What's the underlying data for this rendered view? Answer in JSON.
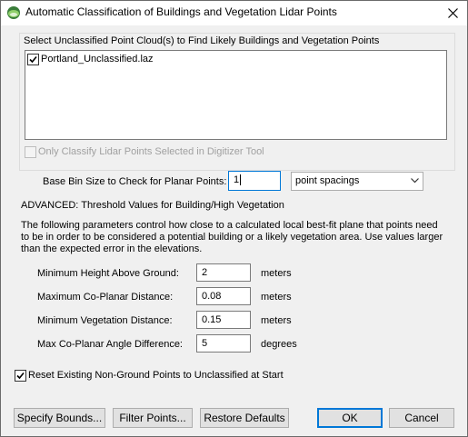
{
  "window": {
    "title": "Automatic Classification of Buildings and Vegetation Lidar Points"
  },
  "point_clouds": {
    "label": "Select Unclassified Point Cloud(s) to Find Likely Buildings and Vegetation Points",
    "items": [
      {
        "name": "Portland_Unclassified.laz",
        "checked": true
      }
    ],
    "only_selected_label": "Only Classify Lidar Points Selected in Digitizer Tool"
  },
  "bin_size": {
    "label": "Base Bin Size to Check for Planar Points:",
    "value": "1",
    "unit_selected": "point spacings"
  },
  "advanced": {
    "heading": "ADVANCED: Threshold Values for Building/High Vegetation",
    "description": [
      "The following parameters control how close to a calculated local best-fit plane that points need",
      "to be in order to be considered a potential building or a likely vegetation area. Use values larger",
      "than the expected error in the elevations."
    ],
    "params": [
      {
        "label": "Minimum Height Above Ground:",
        "value": "2",
        "unit": "meters"
      },
      {
        "label": "Maximum Co-Planar Distance:",
        "value": "0.08",
        "unit": "meters"
      },
      {
        "label": "Minimum Vegetation Distance:",
        "value": "0.15",
        "unit": "meters"
      },
      {
        "label": "Max Co-Planar Angle Difference:",
        "value": "5",
        "unit": "degrees"
      }
    ]
  },
  "reset_option": {
    "label": "Reset Existing Non-Ground Points to Unclassified at Start",
    "checked": true
  },
  "buttons": {
    "specify_bounds": "Specify Bounds...",
    "filter_points": "Filter Points...",
    "restore_defaults": "Restore Defaults",
    "ok": "OK",
    "cancel": "Cancel"
  }
}
